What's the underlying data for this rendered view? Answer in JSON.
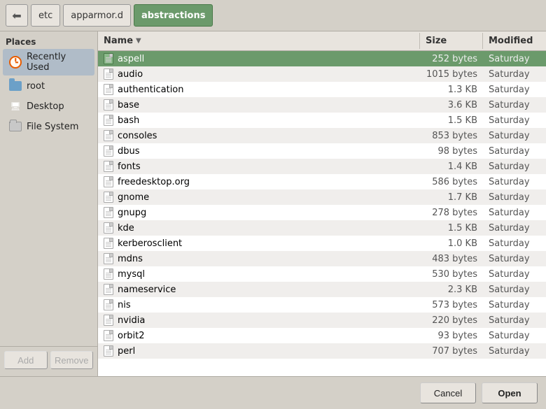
{
  "toolbar": {
    "back_icon": "◀",
    "breadcrumbs": [
      {
        "label": "etc",
        "active": false
      },
      {
        "label": "apparmor.d",
        "active": false
      },
      {
        "label": "abstractions",
        "active": true
      }
    ]
  },
  "sidebar": {
    "header": "Places",
    "items": [
      {
        "id": "recently-used",
        "label": "Recently Used",
        "icon": "clock",
        "active": true
      },
      {
        "id": "root",
        "label": "root",
        "icon": "folder",
        "active": false
      },
      {
        "id": "desktop",
        "label": "Desktop",
        "icon": "desktop",
        "active": false
      },
      {
        "id": "filesystem",
        "label": "File System",
        "icon": "filesystem",
        "active": false
      }
    ],
    "add_label": "Add",
    "remove_label": "Remove"
  },
  "file_list": {
    "columns": {
      "name": "Name",
      "size": "Size",
      "modified": "Modified"
    },
    "files": [
      {
        "name": "aspell",
        "size": "252 bytes",
        "modified": "Saturday",
        "selected": true
      },
      {
        "name": "audio",
        "size": "1015 bytes",
        "modified": "Saturday",
        "selected": false
      },
      {
        "name": "authentication",
        "size": "1.3 KB",
        "modified": "Saturday",
        "selected": false
      },
      {
        "name": "base",
        "size": "3.6 KB",
        "modified": "Saturday",
        "selected": false
      },
      {
        "name": "bash",
        "size": "1.5 KB",
        "modified": "Saturday",
        "selected": false
      },
      {
        "name": "consoles",
        "size": "853 bytes",
        "modified": "Saturday",
        "selected": false
      },
      {
        "name": "dbus",
        "size": "98 bytes",
        "modified": "Saturday",
        "selected": false
      },
      {
        "name": "fonts",
        "size": "1.4 KB",
        "modified": "Saturday",
        "selected": false
      },
      {
        "name": "freedesktop.org",
        "size": "586 bytes",
        "modified": "Saturday",
        "selected": false
      },
      {
        "name": "gnome",
        "size": "1.7 KB",
        "modified": "Saturday",
        "selected": false
      },
      {
        "name": "gnupg",
        "size": "278 bytes",
        "modified": "Saturday",
        "selected": false
      },
      {
        "name": "kde",
        "size": "1.5 KB",
        "modified": "Saturday",
        "selected": false
      },
      {
        "name": "kerberosclient",
        "size": "1.0 KB",
        "modified": "Saturday",
        "selected": false
      },
      {
        "name": "mdns",
        "size": "483 bytes",
        "modified": "Saturday",
        "selected": false
      },
      {
        "name": "mysql",
        "size": "530 bytes",
        "modified": "Saturday",
        "selected": false
      },
      {
        "name": "nameservice",
        "size": "2.3 KB",
        "modified": "Saturday",
        "selected": false
      },
      {
        "name": "nis",
        "size": "573 bytes",
        "modified": "Saturday",
        "selected": false
      },
      {
        "name": "nvidia",
        "size": "220 bytes",
        "modified": "Saturday",
        "selected": false
      },
      {
        "name": "orbit2",
        "size": "93 bytes",
        "modified": "Saturday",
        "selected": false
      },
      {
        "name": "perl",
        "size": "707 bytes",
        "modified": "Saturday",
        "selected": false
      }
    ]
  },
  "buttons": {
    "cancel": "Cancel",
    "open": "Open"
  }
}
